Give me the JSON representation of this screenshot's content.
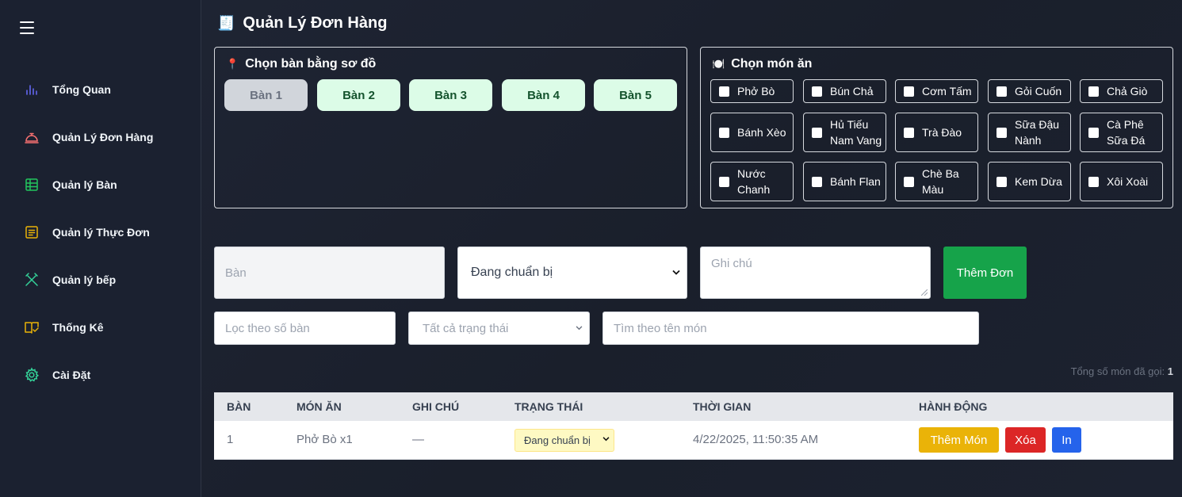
{
  "sidebar": {
    "items": [
      {
        "label": "Tổng Quan",
        "icon": "bar-chart-icon",
        "color": "#6366f1"
      },
      {
        "label": "Quản Lý Đơn Hàng",
        "icon": "bell-service-icon",
        "color": "#f87171"
      },
      {
        "label": "Quản lý Bàn",
        "icon": "table-grid-icon",
        "color": "#22c55e"
      },
      {
        "label": "Quản lý Thực Đơn",
        "icon": "menu-list-icon",
        "color": "#eab308"
      },
      {
        "label": "Quản lý bếp",
        "icon": "utensils-icon",
        "color": "#34d399"
      },
      {
        "label": "Thống Kê",
        "icon": "book-check-icon",
        "color": "#eab308"
      },
      {
        "label": "Cài Đặt",
        "icon": "gear-icon",
        "color": "#34d399"
      }
    ]
  },
  "header": {
    "title": "Quản Lý Đơn Hàng",
    "icon": "receipt-icon"
  },
  "table_map": {
    "title": "Chọn bàn bằng sơ đồ",
    "icon": "pin-icon",
    "tables": [
      "Bàn 1",
      "Bàn 2",
      "Bàn 3",
      "Bàn 4",
      "Bàn 5"
    ]
  },
  "dish_panel": {
    "title": "Chọn món ăn",
    "icon": "plate-icon",
    "dishes": [
      "Phở Bò",
      "Bún Chả",
      "Cơm Tấm",
      "Gỏi Cuốn",
      "Chả Giò",
      "Bánh Xèo",
      "Hủ Tiếu Nam Vang",
      "Trà Đào",
      "Sữa Đậu Nành",
      "Cà Phê Sữa Đá",
      "Nước Chanh",
      "Bánh Flan",
      "Chè Ba Màu",
      "Kem Dừa",
      "Xôi Xoài"
    ]
  },
  "form": {
    "table_placeholder": "Bàn",
    "status_value": "Đang chuẩn bị",
    "note_placeholder": "Ghi chú",
    "add_order_label": "Thêm Đơn"
  },
  "filters": {
    "table_placeholder": "Lọc theo số bàn",
    "status_value": "Tất cả trạng thái",
    "dish_placeholder": "Tìm theo tên món"
  },
  "total": {
    "label": "Tổng số món đã gọi:",
    "value": "1"
  },
  "orders": {
    "headers": [
      "BÀN",
      "MÓN ĂN",
      "GHI CHÚ",
      "TRẠNG THÁI",
      "THỜI GIAN",
      "HÀNH ĐỘNG"
    ],
    "rows": [
      {
        "table": "1",
        "dish": "Phở Bò x1",
        "note": "—",
        "status": "Đang chuẩn bị",
        "time": "4/22/2025, 11:50:35 AM"
      }
    ],
    "actions": {
      "add": "Thêm Món",
      "delete": "Xóa",
      "print": "In"
    }
  }
}
